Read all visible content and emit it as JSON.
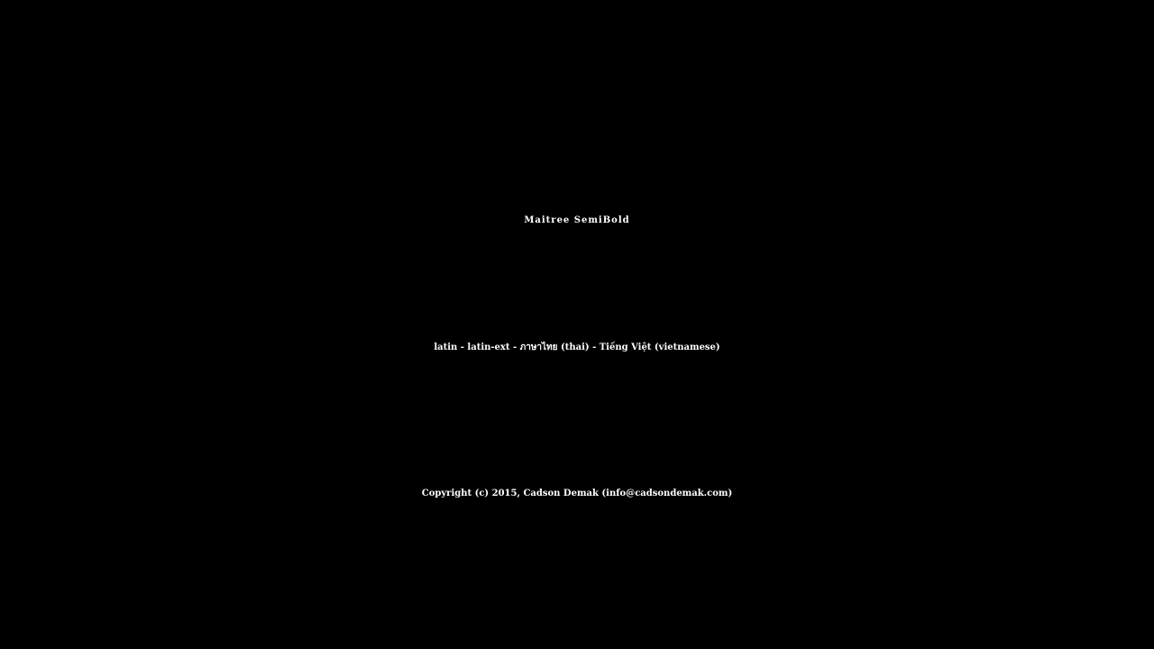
{
  "font_specimen": {
    "title": "Maitree SemiBold",
    "subsets": "latin - latin-ext - ภาษาไทย (thai) - Tiếng Việt (vietnamese)",
    "copyright": "Copyright (c) 2015, Cadson Demak (info@cadsondemak.com)"
  },
  "colors": {
    "background": "#000000",
    "text": "#ffffff"
  }
}
